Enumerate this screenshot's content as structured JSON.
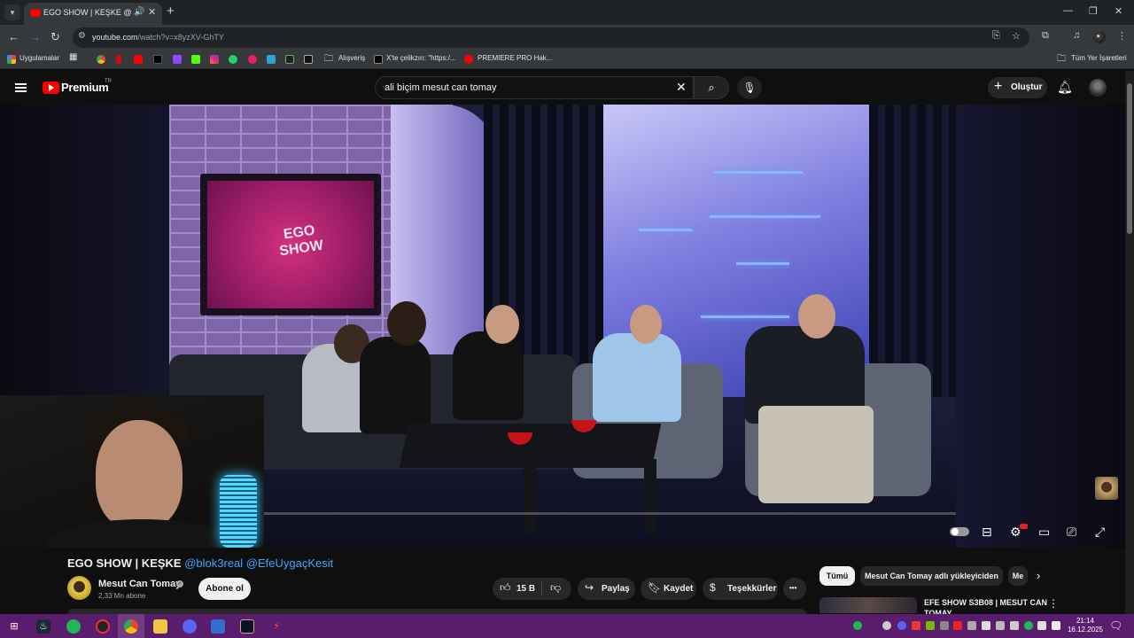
{
  "browser": {
    "tab_title": "EGO SHOW | KEŞKE @blok3real",
    "url_host": "youtube.com",
    "url_path": "/watch?v=x8yzXV-GhTY",
    "bookmarks": {
      "apps": "Uygulamalar",
      "folder_shopping": "Alışveriş",
      "x_link": "X'te çelikzırı: \"https:/...",
      "premiere": "PREMIERE PRO Hak...",
      "all_bookmarks": "Tüm Yer İşaretleri"
    }
  },
  "masthead": {
    "logo_text": "Premium",
    "region": "TR",
    "search_query": "ali biçim mesut can tomay",
    "create_label": "Oluştur"
  },
  "video": {
    "tv_logo_line1": "EGO",
    "tv_logo_line2": "SHOW",
    "title": "EGO SHOW | KEŞKE ",
    "title_tag1": "@blok3real",
    "title_tag2": " @EfeUygaçKesit",
    "channel": "Mesut Can Tomay",
    "subscribers": "2,33 Mn abone",
    "subscribe_label": "Abone ol",
    "likes": "15 B",
    "share_label": "Paylaş",
    "save_label": "Kaydet",
    "thanks_label": "Teşekkürler",
    "more": "•••"
  },
  "sidebar": {
    "chips": [
      "Tümü",
      "Mesut Can Tomay adlı yükleyiciden",
      "Me"
    ],
    "rec_title": "EFE SHOW S3B08 | MESUT CAN TOMAY"
  },
  "taskbar": {
    "time": "21:14",
    "date": "16.12.2025"
  },
  "colors": {
    "yt_red": "#ff0000",
    "link_blue": "#3ea6ff",
    "taskbar_purple": "#5a1d6d"
  }
}
